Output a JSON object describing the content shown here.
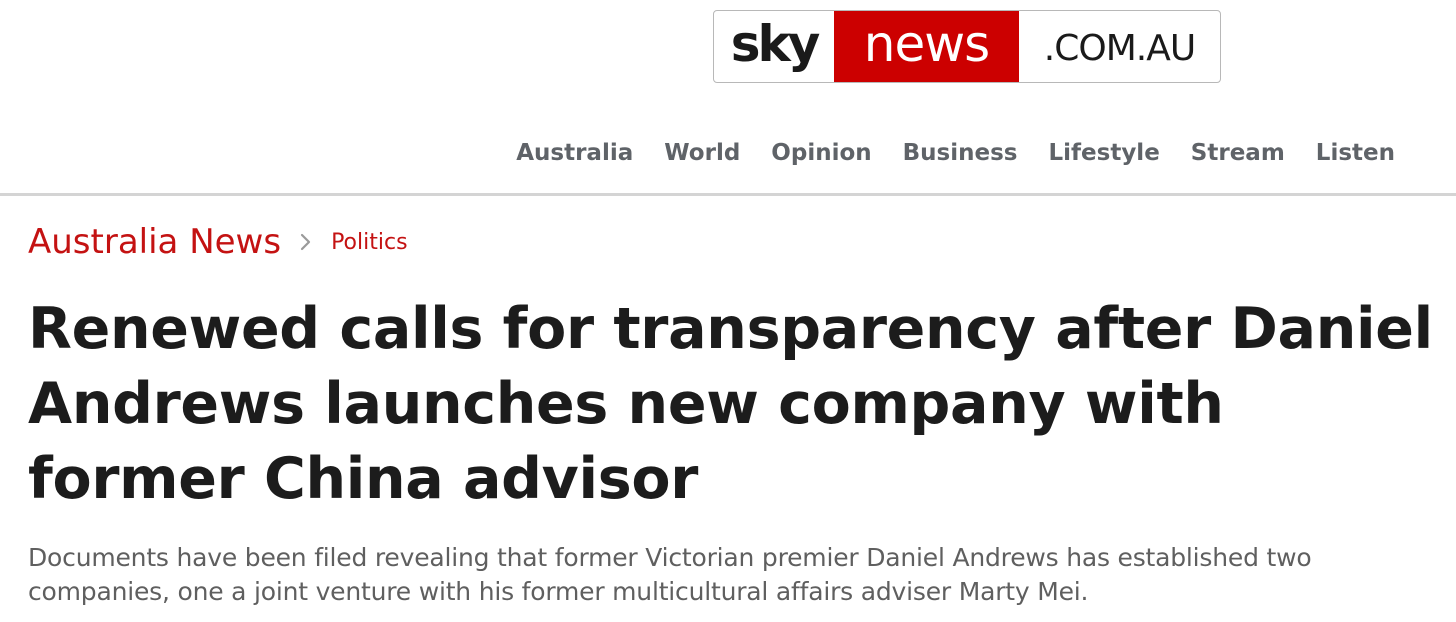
{
  "logo": {
    "sky": "sky",
    "news": "news",
    "domain": ".COM.AU",
    "colors": {
      "red": "#cc0000",
      "dark": "#1a1a1a"
    }
  },
  "nav": {
    "items": [
      {
        "label": "Australia"
      },
      {
        "label": "World"
      },
      {
        "label": "Opinion"
      },
      {
        "label": "Business"
      },
      {
        "label": "Lifestyle"
      },
      {
        "label": "Stream"
      },
      {
        "label": "Listen"
      }
    ]
  },
  "breadcrumb": {
    "section": "Australia News",
    "separator_icon": "chevron-right-icon",
    "subsection": "Politics"
  },
  "article": {
    "headline": "Renewed calls for transparency after Daniel Andrews launches new company with former China advisor",
    "standfirst": "Documents have been filed revealing that former Victorian premier Daniel Andrews has established two companies, one a joint venture with his former multicultural affairs adviser Marty Mei."
  },
  "colors": {
    "accent": "#c41212",
    "nav_text": "#5f6368",
    "headline": "#1c1c1c",
    "standfirst": "#5f5f5f"
  }
}
